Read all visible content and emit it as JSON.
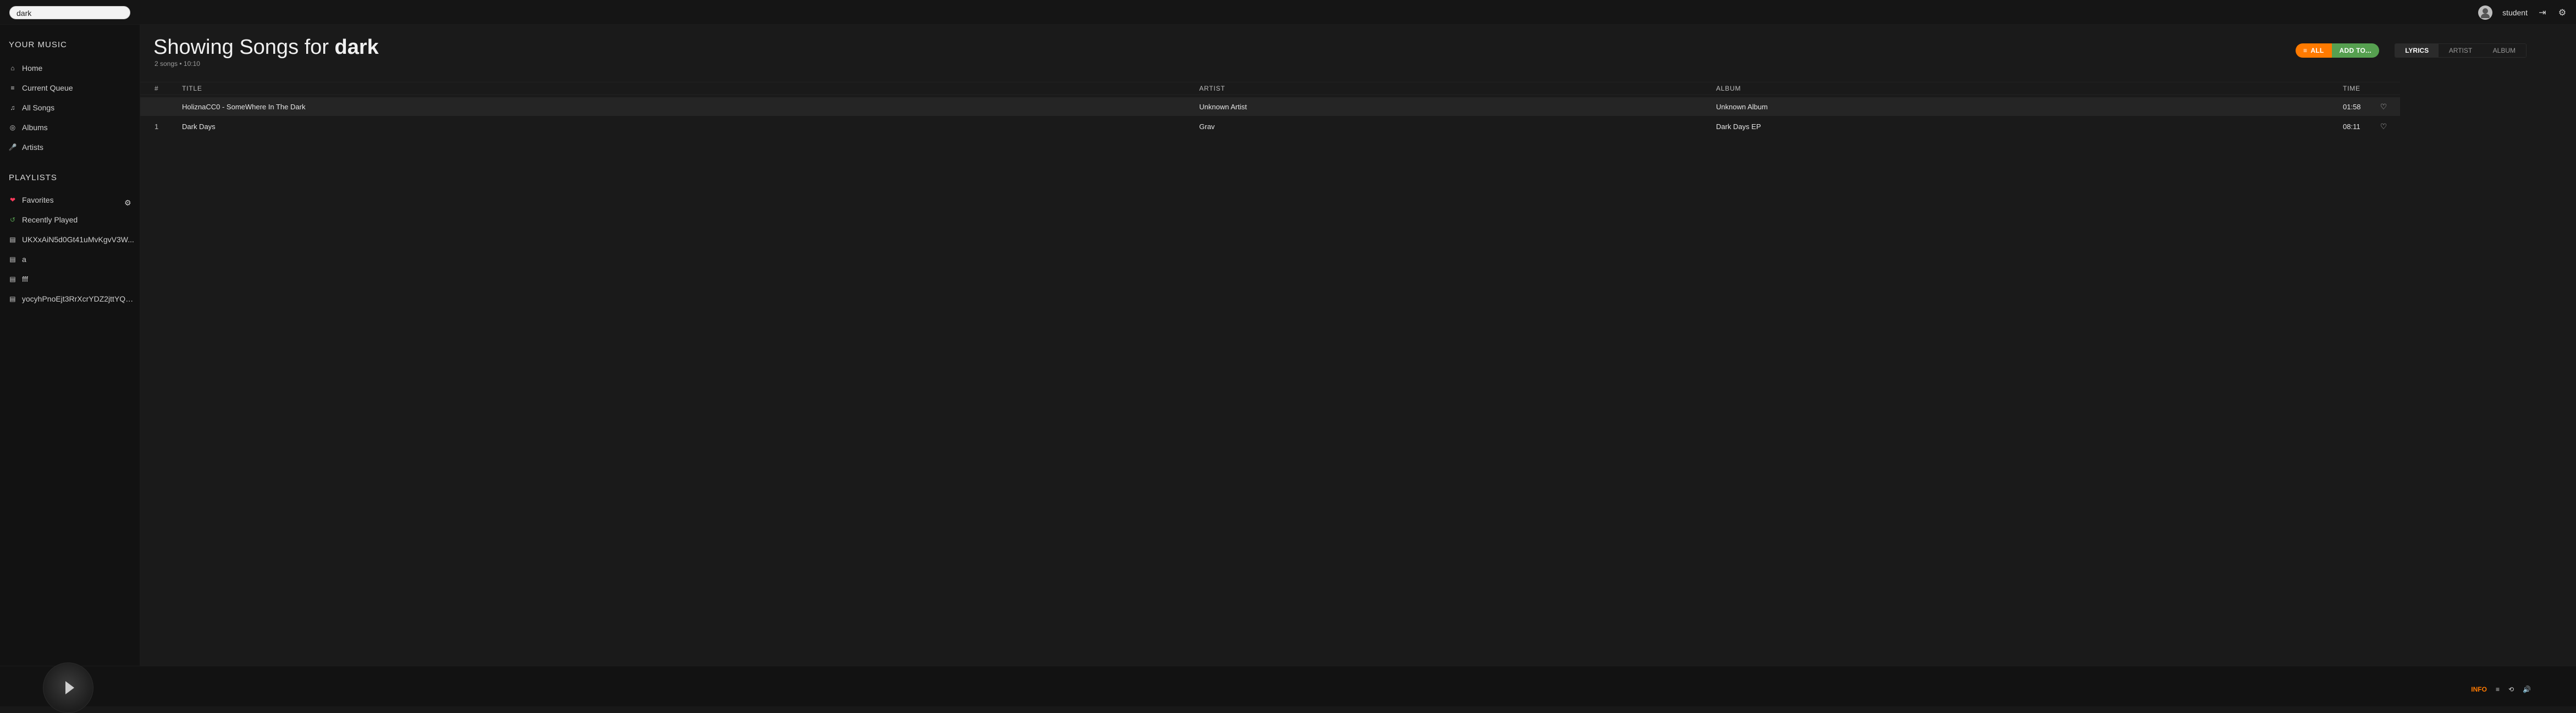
{
  "topbar": {
    "search_value": "dark",
    "username": "student",
    "icons": [
      "avatar-icon",
      "logout-icon",
      "settings-icon"
    ]
  },
  "sidebar": {
    "your_music_title": "YOUR MUSIC",
    "your_music_items": [
      {
        "label": "Home",
        "icon": "home-icon"
      },
      {
        "label": "Current Queue",
        "icon": "queue-icon"
      },
      {
        "label": "All Songs",
        "icon": "music-note-icon"
      },
      {
        "label": "Albums",
        "icon": "album-icon"
      },
      {
        "label": "Artists",
        "icon": "mic-icon"
      }
    ],
    "playlists_title": "PLAYLISTS",
    "playlists_items": [
      {
        "label": "Favorites",
        "icon": "heart-icon",
        "color": "#ff3b5c"
      },
      {
        "label": "Recently Played",
        "icon": "history-icon",
        "color": "#56a050"
      },
      {
        "label": "UKXxAiN5d0Gt41uMvKgvV3W...",
        "icon": "playlist-file-icon",
        "color": "#cfcfcf"
      },
      {
        "label": "a",
        "icon": "playlist-file-icon",
        "color": "#cfcfcf"
      },
      {
        "label": "fff",
        "icon": "playlist-file-icon",
        "color": "#cfcfcf"
      },
      {
        "label": "yocyhPnoEjt3RrXcrYDZ2jttYQh...",
        "icon": "playlist-file-icon",
        "color": "#cfcfcf"
      }
    ],
    "playlist_gear_icon": "gear-icon"
  },
  "main": {
    "title_prefix": "Showing Songs for",
    "title_query": "dark",
    "meta": "2 songs • 10:10",
    "buttons": {
      "all": "ALL",
      "add_to": "ADD TO..."
    },
    "tabs": [
      "LYRICS",
      "ARTIST",
      "ALBUM"
    ],
    "table": {
      "headers": [
        "#",
        "TITLE",
        "ARTIST",
        "ALBUM",
        "TIME"
      ],
      "rows": [
        {
          "num": "",
          "title": "HoliznaCC0 - SomeWhere In The Dark",
          "artist": "Unknown Artist",
          "album": "Unknown Album",
          "time": "01:58"
        },
        {
          "num": "1",
          "title": "Dark Days",
          "artist": "Grav",
          "album": "Dark Days EP",
          "time": "08:11"
        }
      ]
    }
  },
  "player": {
    "info_label": "INFO",
    "icons": [
      "playlist-icon",
      "repeat-icon",
      "volume-icon"
    ]
  },
  "colors": {
    "orange": "#ff7a00",
    "green": "#56a050",
    "favorites": "#ff3b5c"
  }
}
